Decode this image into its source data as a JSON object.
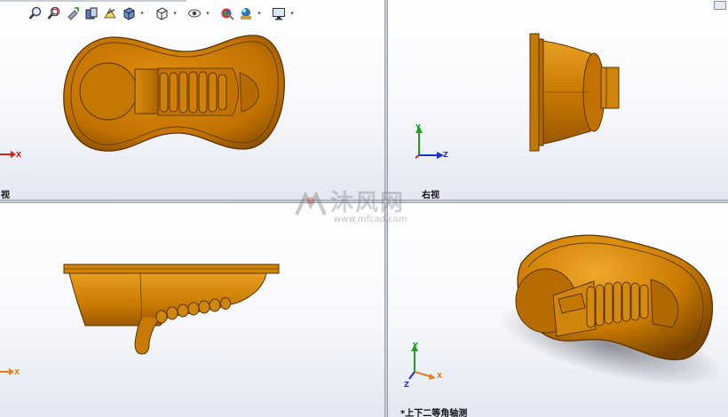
{
  "viewports": {
    "top_left": {
      "label": "视"
    },
    "top_right": {
      "label": "右视"
    },
    "bottom_left": {
      "label": ""
    },
    "bottom_right": {
      "label": "*上下二等角轴测"
    }
  },
  "triad": {
    "x": "X",
    "y": "Y",
    "z": "Z"
  },
  "watermark": {
    "text": "沐风网",
    "url": "www.mfcad.com"
  },
  "toolbar": {
    "icons": [
      "zoom-to-fit-icon",
      "zoom-area-icon",
      "previous-view-icon",
      "section-view-icon",
      "dynamic-annotation-icon",
      "view-orientation-icon",
      "display-style-icon",
      "hide-show-icon",
      "edit-appearance-icon",
      "apply-scene-icon",
      "view-settings-icon"
    ]
  },
  "colors": {
    "part": "#c97a00",
    "part_dark": "#7a4500",
    "part_light": "#f0a830",
    "axis_x": "#d02020",
    "axis_y": "#20a020",
    "axis_z": "#2030d0"
  }
}
